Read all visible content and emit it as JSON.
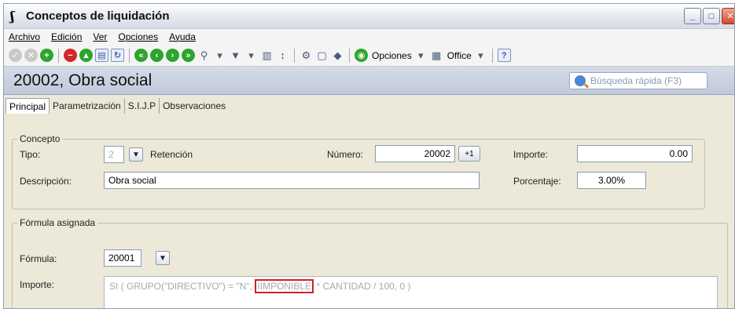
{
  "window": {
    "title": "Conceptos de liquidación",
    "icon": "spring-icon"
  },
  "menu": [
    "Archivo",
    "Edición",
    "Ver",
    "Opciones",
    "Ayuda"
  ],
  "toolbar": {
    "opciones_label": "Opciones",
    "office_label": "Office"
  },
  "record": {
    "title": "20002, Obra social"
  },
  "search": {
    "placeholder": "Búsqueda rápida (F3)"
  },
  "tabs": [
    "Principal",
    "Parametrización",
    "S.I.J.P",
    "Observaciones"
  ],
  "concepto": {
    "legend": "Concepto",
    "tipo_label": "Tipo:",
    "tipo_value": "2",
    "tipo_text": "Retención",
    "numero_label": "Número:",
    "numero_value": "20002",
    "importe_label": "Importe:",
    "importe_value": "0.00",
    "descripcion_label": "Descripción:",
    "descripcion_value": "Obra social",
    "porcentaje_label": "Porcentaje:",
    "porcentaje_value": "3.00%"
  },
  "formula": {
    "legend": "Fórmula asignada",
    "formula_label": "Fórmula:",
    "formula_value": "20001",
    "importe_label": "Importe:",
    "expr_prefix": "SI ( GRUPO(\"DIRECTIVO\") = \"N\",",
    "expr_highlight": "IIMPONIBLE",
    "expr_suffix": "* CANTIDAD / 100, 0 )"
  },
  "colors": {
    "highlight": "#d41f1f",
    "header_band": "#c8d0df"
  }
}
